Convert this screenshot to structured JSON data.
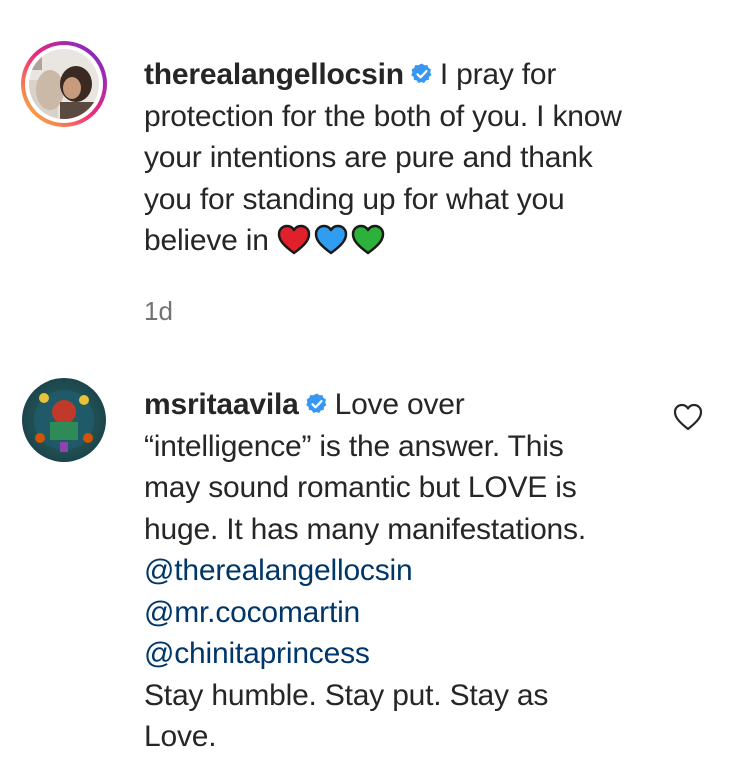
{
  "comments": [
    {
      "username": "therealangellocsin",
      "verified": true,
      "lines": [
        "I pray for",
        "protection for the both of you. I know",
        "your intentions are pure and thank",
        "you for standing up for what you",
        "believe in"
      ],
      "emoji": [
        "red-heart",
        "blue-heart",
        "green-heart"
      ],
      "age": "1d"
    },
    {
      "username": "msritaavila",
      "verified": true,
      "lines": [
        "Love over",
        "“intelligence” is the answer. This",
        "may sound romantic but LOVE is",
        "huge. It has many manifestations."
      ],
      "mentions": [
        "@therealangellocsin",
        "@mr.cocomartin",
        "@chinitaprincess"
      ],
      "closing_lines": [
        "Stay humble. Stay put. Stay as",
        "Love."
      ]
    }
  ],
  "colors": {
    "text": "#262626",
    "mention": "#00376b",
    "meta": "#737373",
    "verified": "#3897f0",
    "story_ring_start": "#f9ce34",
    "story_ring_mid": "#ee2a7b",
    "story_ring_end": "#6228d7"
  },
  "icons": {
    "verified": "verified-badge-icon",
    "like": "heart-outline-icon"
  }
}
